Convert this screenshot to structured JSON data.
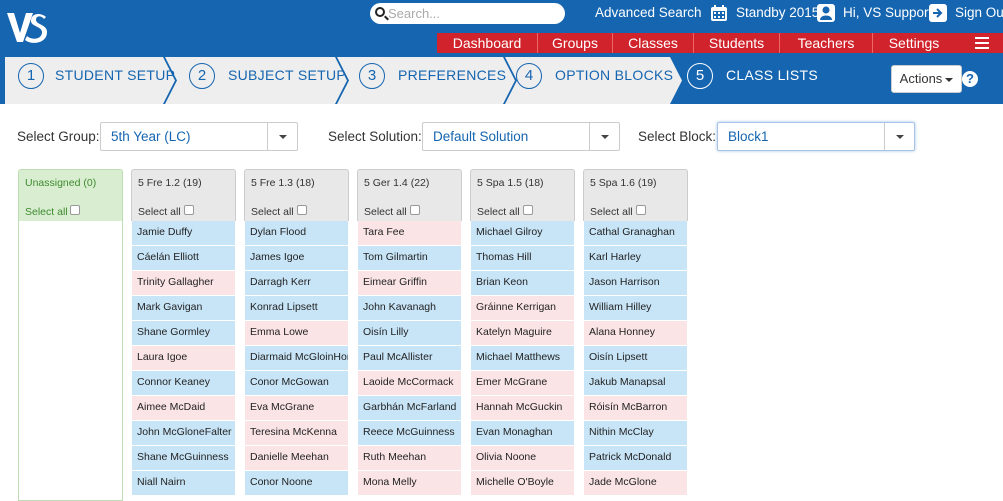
{
  "header": {
    "search_placeholder": "Search...",
    "advanced_search": "Advanced Search",
    "year": "Standby 2015",
    "user": "Hi, VS Support",
    "signout": "Sign Out"
  },
  "nav": [
    "Dashboard",
    "Groups",
    "Classes",
    "Students",
    "Teachers",
    "Settings"
  ],
  "steps": [
    {
      "num": "1",
      "label": "STUDENT SETUP"
    },
    {
      "num": "2",
      "label": "SUBJECT SETUP"
    },
    {
      "num": "3",
      "label": "PREFERENCES"
    },
    {
      "num": "4",
      "label": "OPTION BLOCKS"
    },
    {
      "num": "5",
      "label": "CLASS LISTS"
    }
  ],
  "actions_label": "Actions",
  "help_label": "?",
  "filters": {
    "group_label": "Select Group:",
    "group_value": "5th Year (LC)",
    "solution_label": "Select Solution:",
    "solution_value": "Default Solution",
    "block_label": "Select Block:",
    "block_value": "Block1"
  },
  "unassigned": {
    "title": "Unassigned (0)",
    "select_all": "Select all"
  },
  "select_all_label": "Select all",
  "columns": [
    {
      "title": "5 Fre 1.2 (19)",
      "students": [
        {
          "name": "Jamie Duffy",
          "c": "b"
        },
        {
          "name": "Cáelán Elliott",
          "c": "b"
        },
        {
          "name": "Trinity Gallagher",
          "c": "p"
        },
        {
          "name": "Mark Gavigan",
          "c": "b"
        },
        {
          "name": "Shane Gormley",
          "c": "b"
        },
        {
          "name": "Laura Igoe",
          "c": "p"
        },
        {
          "name": "Connor Keaney",
          "c": "b"
        },
        {
          "name": "Aimee McDaid",
          "c": "p"
        },
        {
          "name": "John McGloneFalter",
          "c": "b"
        },
        {
          "name": "Shane McGuinness",
          "c": "b"
        },
        {
          "name": "Niall Nairn",
          "c": "b"
        }
      ]
    },
    {
      "title": "5 Fre 1.3 (18)",
      "students": [
        {
          "name": "Dylan Flood",
          "c": "b"
        },
        {
          "name": "James Igoe",
          "c": "b"
        },
        {
          "name": "Darragh Kerr",
          "c": "b"
        },
        {
          "name": "Konrad Lipsett",
          "c": "b"
        },
        {
          "name": "Emma Lowe",
          "c": "p"
        },
        {
          "name": "Diarmaid McGloinHoma",
          "c": "b"
        },
        {
          "name": "Conor McGowan",
          "c": "b"
        },
        {
          "name": "Eva McGrane",
          "c": "p"
        },
        {
          "name": "Teresina McKenna",
          "c": "p"
        },
        {
          "name": "Danielle Meehan",
          "c": "p"
        },
        {
          "name": "Conor Noone",
          "c": "b"
        }
      ]
    },
    {
      "title": "5 Ger 1.4 (22)",
      "students": [
        {
          "name": "Tara Fee",
          "c": "p"
        },
        {
          "name": "Tom Gilmartin",
          "c": "b"
        },
        {
          "name": "Eimear Griffin",
          "c": "p"
        },
        {
          "name": "John Kavanagh",
          "c": "b"
        },
        {
          "name": "Oisín Lilly",
          "c": "b"
        },
        {
          "name": "Paul McAllister",
          "c": "b"
        },
        {
          "name": "Laoide McCormack",
          "c": "p"
        },
        {
          "name": "Garbhán McFarland",
          "c": "b"
        },
        {
          "name": "Reece McGuinness",
          "c": "b"
        },
        {
          "name": "Ruth Meehan",
          "c": "p"
        },
        {
          "name": "Mona Melly",
          "c": "p"
        }
      ]
    },
    {
      "title": "5 Spa 1.5 (18)",
      "students": [
        {
          "name": "Michael Gilroy",
          "c": "b"
        },
        {
          "name": "Thomas Hill",
          "c": "b"
        },
        {
          "name": "Brian Keon",
          "c": "b"
        },
        {
          "name": "Gráinne Kerrigan",
          "c": "p"
        },
        {
          "name": "Katelyn Maguire",
          "c": "p"
        },
        {
          "name": "Michael Matthews",
          "c": "b"
        },
        {
          "name": "Emer McGrane",
          "c": "p"
        },
        {
          "name": "Hannah McGuckin",
          "c": "p"
        },
        {
          "name": "Evan Monaghan",
          "c": "b"
        },
        {
          "name": "Olivia Noone",
          "c": "p"
        },
        {
          "name": "Michelle O'Boyle",
          "c": "p"
        }
      ]
    },
    {
      "title": "5 Spa 1.6 (19)",
      "students": [
        {
          "name": "Cathal Granaghan",
          "c": "b"
        },
        {
          "name": "Karl Harley",
          "c": "b"
        },
        {
          "name": "Jason Harrison",
          "c": "b"
        },
        {
          "name": "William Hilley",
          "c": "b"
        },
        {
          "name": "Alana Honney",
          "c": "p"
        },
        {
          "name": "Oisín Lipsett",
          "c": "b"
        },
        {
          "name": "Jakub Manapsal",
          "c": "b"
        },
        {
          "name": "Róisín McBarron",
          "c": "p"
        },
        {
          "name": "Nithin McClay",
          "c": "b"
        },
        {
          "name": "Patrick McDonald",
          "c": "b"
        },
        {
          "name": "Jade McGlone",
          "c": "p"
        }
      ]
    }
  ]
}
